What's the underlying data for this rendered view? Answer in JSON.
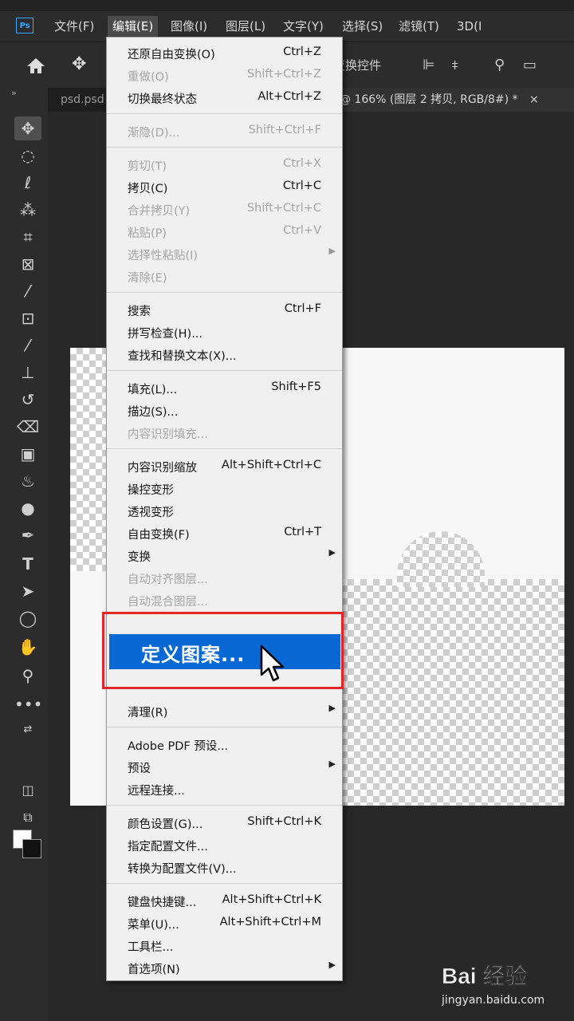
{
  "app": {
    "logo_text": "Ps",
    "menubar": [
      {
        "label": "文件(F)"
      },
      {
        "label": "编辑(E)"
      },
      {
        "label": "图像(I)"
      },
      {
        "label": "图层(L)"
      },
      {
        "label": "文字(Y)"
      },
      {
        "label": "选择(S)"
      },
      {
        "label": "滤镜(T)"
      },
      {
        "label": "3D(I"
      }
    ],
    "options_bar": {
      "transform_controls_label": "变换控件"
    },
    "tabs": [
      {
        "label": "psd.psd"
      },
      {
        "label": "@ 166% (图层 2 拷贝, RGB/8#) *"
      }
    ],
    "tab_close_glyph": "×",
    "tools": [
      "move-icon",
      "marquee-icon",
      "lasso-icon",
      "magic-wand-icon",
      "crop-icon",
      "frame-icon",
      "eyedropper-icon",
      "healing-brush-icon",
      "brush-icon",
      "stamp-icon",
      "history-brush-icon",
      "eraser-icon",
      "gradient-icon",
      "blur-icon",
      "dodge-icon",
      "pen-icon",
      "type-icon",
      "path-select-icon",
      "ellipse-icon",
      "hand-icon",
      "zoom-icon",
      "more-icon"
    ]
  },
  "edit_menu": {
    "items": [
      {
        "label": "还原自由变换(O)",
        "shortcut": "Ctrl+Z",
        "disabled": false
      },
      {
        "label": "重做(O)",
        "shortcut": "Shift+Ctrl+Z",
        "disabled": true
      },
      {
        "label": "切换最终状态",
        "shortcut": "Alt+Ctrl+Z",
        "disabled": false
      },
      {
        "label": "渐隐(D)...",
        "shortcut": "Shift+Ctrl+F",
        "disabled": true
      },
      {
        "label": "剪切(T)",
        "shortcut": "Ctrl+X",
        "disabled": true
      },
      {
        "label": "拷贝(C)",
        "shortcut": "Ctrl+C",
        "disabled": false
      },
      {
        "label": "合并拷贝(Y)",
        "shortcut": "Shift+Ctrl+C",
        "disabled": true
      },
      {
        "label": "粘贴(P)",
        "shortcut": "Ctrl+V",
        "disabled": true
      },
      {
        "label": "选择性粘贴(I)",
        "shortcut": "",
        "disabled": true,
        "submenu": true
      },
      {
        "label": "清除(E)",
        "shortcut": "",
        "disabled": true
      },
      {
        "label": "搜索",
        "shortcut": "Ctrl+F",
        "disabled": false
      },
      {
        "label": "拼写检查(H)...",
        "shortcut": "",
        "disabled": false
      },
      {
        "label": "查找和替换文本(X)...",
        "shortcut": "",
        "disabled": false
      },
      {
        "label": "填充(L)...",
        "shortcut": "Shift+F5",
        "disabled": false
      },
      {
        "label": "描边(S)...",
        "shortcut": "",
        "disabled": false
      },
      {
        "label": "内容识别填充...",
        "shortcut": "",
        "disabled": true
      },
      {
        "label": "内容识别缩放",
        "shortcut": "Alt+Shift+Ctrl+C",
        "disabled": false
      },
      {
        "label": "操控变形",
        "shortcut": "",
        "disabled": false
      },
      {
        "label": "透视变形",
        "shortcut": "",
        "disabled": false
      },
      {
        "label": "自由变换(F)",
        "shortcut": "Ctrl+T",
        "disabled": false
      },
      {
        "label": "变换",
        "shortcut": "",
        "disabled": false,
        "submenu": true
      },
      {
        "label": "自动对齐图层...",
        "shortcut": "",
        "disabled": true
      },
      {
        "label": "自动混合图层...",
        "shortcut": "",
        "disabled": true
      },
      {
        "label": "清理(R)",
        "shortcut": "",
        "disabled": false,
        "submenu": true
      },
      {
        "label": "Adobe PDF 预设...",
        "shortcut": "",
        "disabled": false
      },
      {
        "label": "预设",
        "shortcut": "",
        "disabled": false,
        "submenu": true
      },
      {
        "label": "远程连接...",
        "shortcut": "",
        "disabled": false
      },
      {
        "label": "颜色设置(G)...",
        "shortcut": "Shift+Ctrl+K",
        "disabled": false
      },
      {
        "label": "指定配置文件...",
        "shortcut": "",
        "disabled": false
      },
      {
        "label": "转换为配置文件(V)...",
        "shortcut": "",
        "disabled": false
      },
      {
        "label": "键盘快捷键...",
        "shortcut": "Alt+Shift+Ctrl+K",
        "disabled": false
      },
      {
        "label": "菜单(U)...",
        "shortcut": "Alt+Shift+Ctrl+M",
        "disabled": false
      },
      {
        "label": "工具栏...",
        "shortcut": "",
        "disabled": false
      },
      {
        "label": "首选项(N)",
        "shortcut": "",
        "disabled": false,
        "submenu": true
      }
    ],
    "highlighted": {
      "label": "定义图案..."
    }
  },
  "colors": {
    "highlight": "#0a68d4",
    "annotation_box": "#e0262b"
  },
  "watermark": {
    "logo_text": "Bai 经验",
    "url": "jingyan.baidu.com"
  }
}
